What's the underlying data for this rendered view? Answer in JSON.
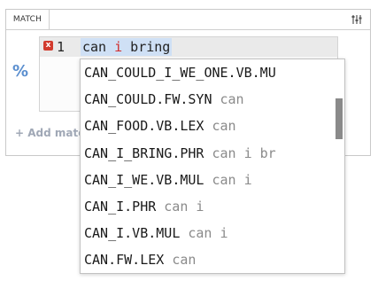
{
  "panel": {
    "tab_label": "MATCH",
    "filter_icon": "sliders-icon"
  },
  "percent_icon": "%",
  "editor": {
    "error_icon": "x",
    "line_number": "1",
    "code": {
      "before": "can ",
      "keyword": "i",
      "after": " bring"
    }
  },
  "add_match_label": "+ Add matc",
  "dropdown": {
    "items": [
      {
        "name": "CAN_COULD_I_WE_ONE.VB.MU",
        "hint": ""
      },
      {
        "name": "CAN_COULD.FW.SYN",
        "hint": "can"
      },
      {
        "name": "CAN_FOOD.VB.LEX",
        "hint": "can"
      },
      {
        "name": "CAN_I_BRING.PHR",
        "hint": "can i br"
      },
      {
        "name": "CAN_I_WE.VB.MUL",
        "hint": "can i"
      },
      {
        "name": "CAN_I.PHR",
        "hint": "can i"
      },
      {
        "name": "CAN_I.VB.MUL",
        "hint": "can i"
      },
      {
        "name": "CAN.FW.LEX",
        "hint": "can"
      }
    ]
  }
}
